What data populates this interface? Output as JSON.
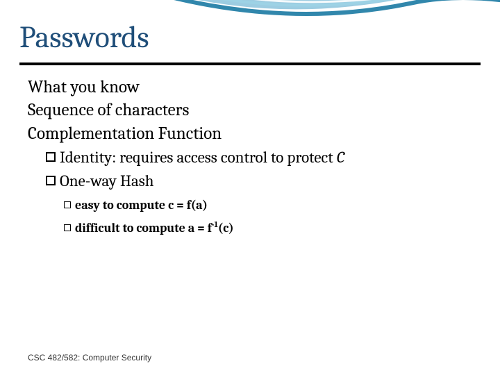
{
  "title": "Passwords",
  "bullets": {
    "b1": "What you know",
    "b2": "Sequence of characters",
    "b3": "Complementation Function",
    "b3a_prefix": "Identity: requires access control to protect ",
    "b3a_italic": "C",
    "b3b": "One-way Hash",
    "b3b1_text": "easy to compute c = f(a)",
    "b3b2_prefix": "difficult to compute a = f",
    "b3b2_sup": "-1",
    "b3b2_suffix": "(c)"
  },
  "footer": "CSC 482/582: Computer Security"
}
